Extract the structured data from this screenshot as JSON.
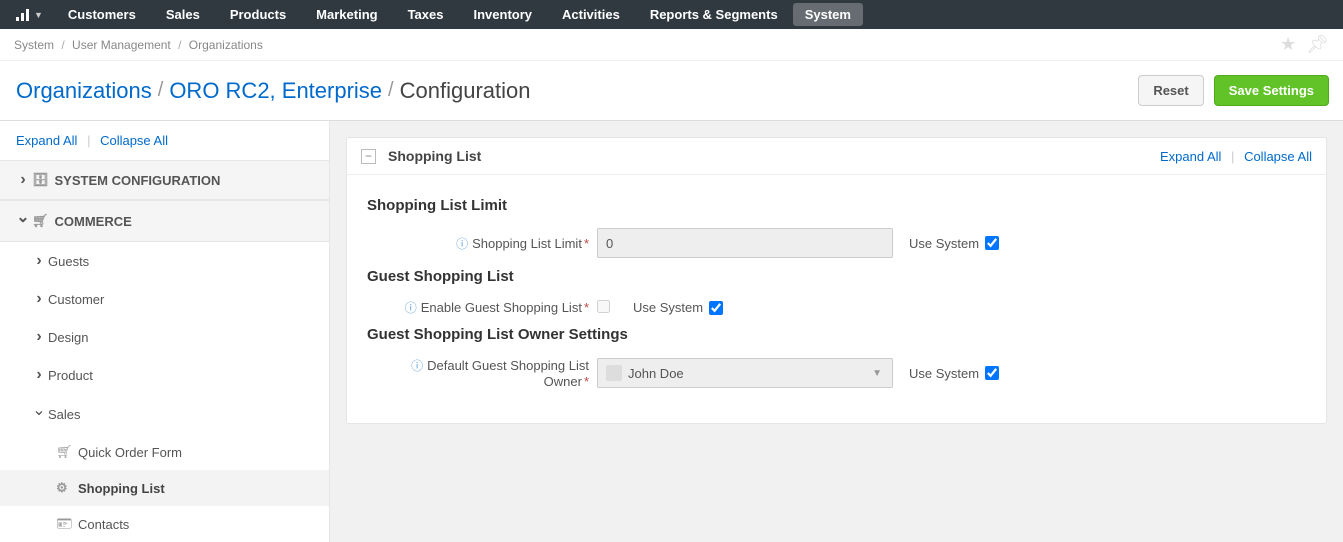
{
  "topnav": {
    "items": [
      "Customers",
      "Sales",
      "Products",
      "Marketing",
      "Taxes",
      "Inventory",
      "Activities",
      "Reports & Segments",
      "System"
    ],
    "active": "System"
  },
  "breadcrumbs": {
    "items": [
      "System",
      "User Management",
      "Organizations"
    ]
  },
  "title": {
    "org_root": "Organizations",
    "org_name": "ORO RC2, Enterprise",
    "current": "Configuration"
  },
  "buttons": {
    "reset": "Reset",
    "save": "Save Settings"
  },
  "sidebar": {
    "expand_all": "Expand All",
    "collapse_all": "Collapse All",
    "groups": {
      "system_config": "SYSTEM CONFIGURATION",
      "commerce": "COMMERCE"
    },
    "commerce_subs": {
      "guests": "Guests",
      "customer": "Customer",
      "design": "Design",
      "product": "Product",
      "sales": "Sales"
    },
    "leaves": {
      "quick_order": "Quick Order Form",
      "shopping_list": "Shopping List",
      "contacts": "Contacts"
    }
  },
  "panel": {
    "title": "Shopping List",
    "expand_all": "Expand All",
    "collapse_all": "Collapse All",
    "sections": {
      "limit": {
        "title": "Shopping List Limit",
        "field_label": "Shopping List Limit",
        "value": "0"
      },
      "guest": {
        "title": "Guest Shopping List",
        "field_label": "Enable Guest Shopping List"
      },
      "owner": {
        "title": "Guest Shopping List Owner Settings",
        "field_label": "Default Guest Shopping List Owner",
        "value": "John Doe"
      }
    },
    "use_system": "Use System"
  }
}
